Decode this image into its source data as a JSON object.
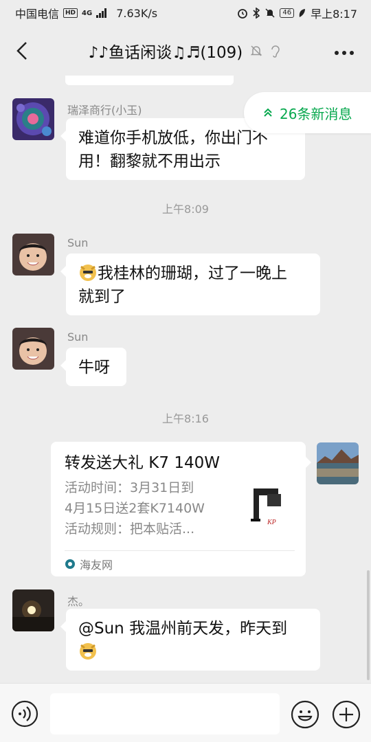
{
  "status": {
    "carrier": "中国电信",
    "hd": "HD",
    "network": "4G",
    "speed": "7.63K/s",
    "battery": "46",
    "time": "早上8:17"
  },
  "header": {
    "title": "♪♪鱼话闲谈♫♬(109)"
  },
  "new_messages": {
    "label": "26条新消息",
    "accent": "#07a84e"
  },
  "messages": [
    {
      "sender": "瑞泽商行(小玉)",
      "line1": "难道你手机放低，你出门不",
      "line2": "用！翻黎就不用出示"
    },
    {
      "timestamp": "上午8:09"
    },
    {
      "sender": "Sun",
      "line1": "我桂林的珊瑚，过了一晚上",
      "line2": "就到了"
    },
    {
      "sender": "Sun",
      "line1": "牛呀"
    },
    {
      "timestamp": "上午8:16"
    },
    {
      "sender": "杰。",
      "line1": "@Sun 我温州前天发，昨天到"
    }
  ],
  "card": {
    "title": "转发送大礼 K7 140W",
    "desc1": "活动时间：3月31日到",
    "desc2": "4月15日送2套K7140W",
    "desc3": "活动规则：把本贴活...",
    "source": "海友网"
  },
  "icons": {
    "back": "back-arrow-icon",
    "mute": "muted-bell-icon",
    "ear": "ear-icon",
    "more": "more-dots-icon",
    "voice": "voice-icon",
    "emoji": "emoji-icon",
    "plus": "plus-icon"
  }
}
